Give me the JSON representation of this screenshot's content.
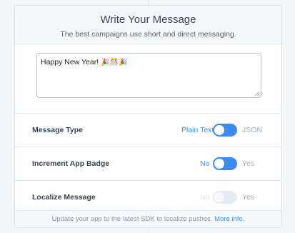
{
  "header": {
    "title": "Write Your Message",
    "subtitle": "The best campaigns use short and direct messaging."
  },
  "composer": {
    "message_text": "Happy New Year!",
    "emoji": "🎉🎊🎉"
  },
  "settings": [
    {
      "label": "Message Type",
      "left": "Plain Text",
      "right": "JSON",
      "state": "left",
      "enabled": true
    },
    {
      "label": "Increment App Badge",
      "left": "No",
      "right": "Yes",
      "state": "left",
      "enabled": true
    },
    {
      "label": "Localize Message",
      "left": "No",
      "right": "Yes",
      "state": "left",
      "enabled": false
    }
  ],
  "footer": {
    "text": "Update your app to the latest SDK to localize pushes.",
    "link": "More info."
  },
  "colors": {
    "accent": "#3d8bf0",
    "muted": "#a3acb6"
  }
}
